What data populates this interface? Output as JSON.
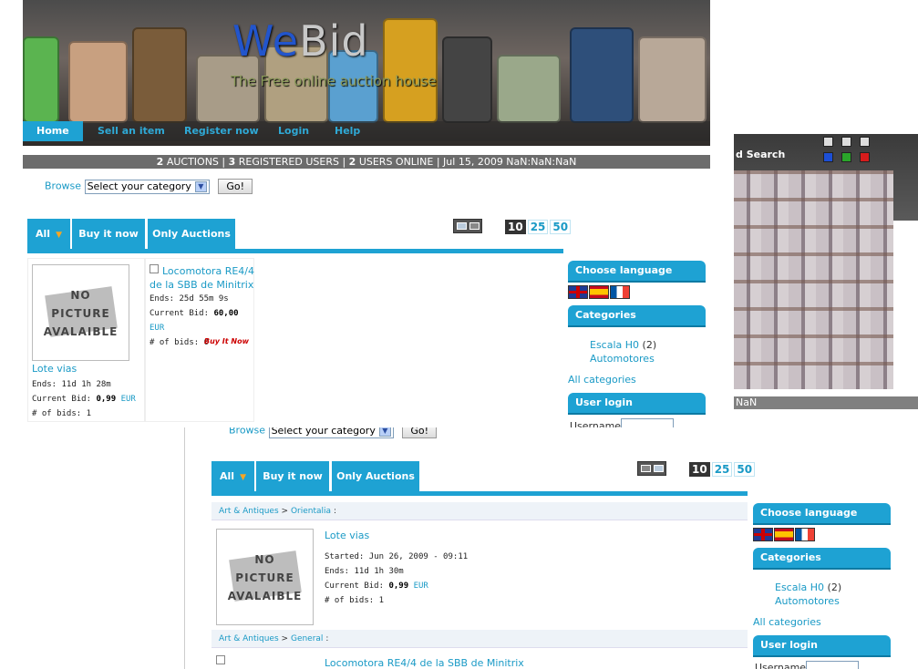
{
  "top": {
    "logo": {
      "we": "We",
      "bid": "Bid"
    },
    "tagline": "The Free online auction house",
    "nav": [
      "Home",
      "Sell an item",
      "Register now",
      "Login",
      "Help"
    ],
    "stats": {
      "auctions": "2",
      "auctions_label": "AUCTIONS",
      "users": "3",
      "users_label": "REGISTERED USERS",
      "online": "2",
      "online_label": "USERS ONLINE",
      "date": "| Jul 15, 2009 NaN:NaN:NaN"
    },
    "browse_label": "Browse",
    "category_select": "Select your category",
    "go": "Go!",
    "tabs": [
      "All",
      "Buy it now",
      "Only Auctions"
    ],
    "perpage": [
      "10",
      "25",
      "50"
    ],
    "items": [
      {
        "title": "Lote vias",
        "ends_label": "Ends:",
        "ends": "11d 1h 28m",
        "bid_label": "Current Bid:",
        "bid": "0,99",
        "currency": "EUR",
        "bids_label": "# of bids:",
        "bids": "1"
      },
      {
        "title": "Locomotora RE4/4 de la SBB de Minitrix",
        "ends_label": "Ends:",
        "ends": "25d 55m 9s",
        "bid_label": "Current Bid:",
        "bid": "60,00",
        "currency": "EUR",
        "bids_label": "# of bids:",
        "bids": "0",
        "buy_now": "Buy It Now"
      }
    ],
    "nopic": {
      "l1": "NO",
      "l2": "PICTURE",
      "l3": "AVALAIBLE"
    },
    "sidebar": {
      "language": "Choose language",
      "categories": "Categories",
      "cat_items": [
        {
          "name": "Escala H0",
          "count": "(2)"
        },
        {
          "name": "Automotores",
          "count": ""
        }
      ],
      "all_categories": "All categories",
      "user_login": "User login",
      "username": "Username"
    }
  },
  "right": {
    "search": "d Search",
    "status": "NaN"
  },
  "bottom": {
    "browse_label": "Browse",
    "category_select": "Select your category",
    "go": "Go!",
    "tabs": [
      "All",
      "Buy it now",
      "Only Auctions"
    ],
    "perpage": [
      "10",
      "25",
      "50"
    ],
    "rows": [
      {
        "crumb_a": "Art & Antiques",
        "crumb_b": "Orientalia",
        "title": "Lote vias",
        "started_label": "Started:",
        "started": "Jun 26, 2009 - 09:11",
        "ends_label": "Ends:",
        "ends": "11d 1h 30m",
        "bid_label": "Current Bid:",
        "bid": "0,99",
        "currency": "EUR",
        "bids_label": "# of bids:",
        "bids": "1"
      },
      {
        "crumb_a": "Art & Antiques",
        "crumb_b": "General",
        "title": "Locomotora RE4/4 de la SBB de Minitrix"
      }
    ],
    "sidebar": {
      "language": "Choose language",
      "categories": "Categories",
      "cat_items": [
        {
          "name": "Escala H0",
          "count": "(2)"
        },
        {
          "name": "Automotores",
          "count": ""
        }
      ],
      "all_categories": "All categories",
      "user_login": "User login",
      "username": "Username"
    }
  }
}
